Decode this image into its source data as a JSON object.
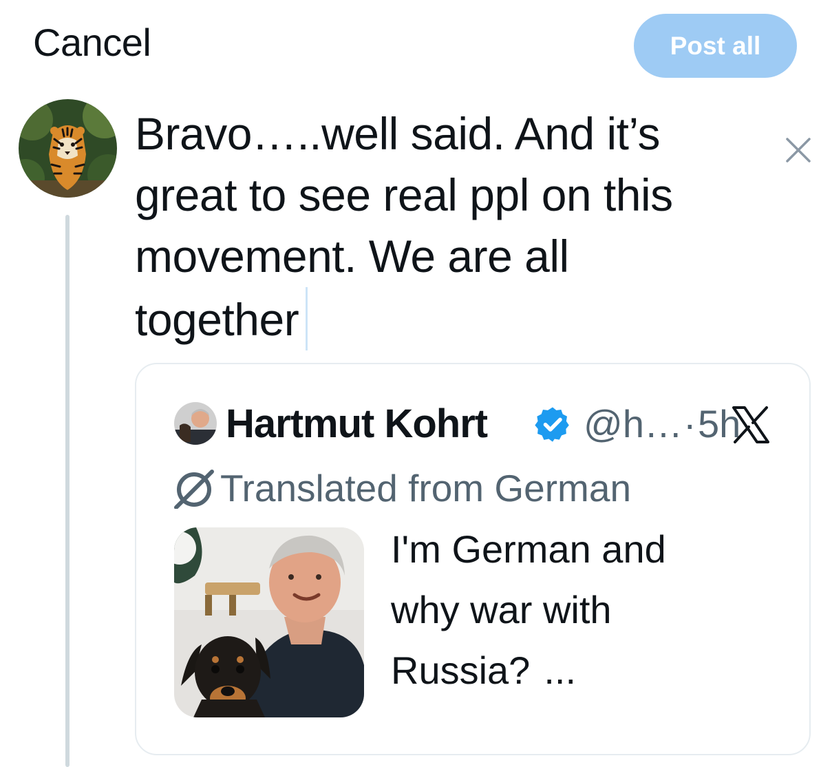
{
  "header": {
    "cancel_label": "Cancel",
    "post_all_label": "Post all"
  },
  "compose": {
    "lines": [
      "Bravo…..well said. And it’s",
      "great to see real ppl on this",
      "movement. We are all",
      "together"
    ]
  },
  "quote": {
    "author_name": "Hartmut Kohrt",
    "handle": "@h…",
    "separator": "·",
    "time": "5h",
    "translated_label": "Translated from German",
    "text_lines": [
      "I'm German and",
      "why war with",
      "Russia?"
    ],
    "ellipsis": "..."
  },
  "colors": {
    "post_button_bg": "#9ecbf4",
    "verified_badge": "#1d9bf0",
    "secondary_text": "#536471",
    "thread_line": "#cfd9de"
  },
  "icons": {
    "close": "close-icon",
    "verified": "verified-badge-icon",
    "translate": "translate-icon",
    "x_logo": "x-logo-icon"
  }
}
